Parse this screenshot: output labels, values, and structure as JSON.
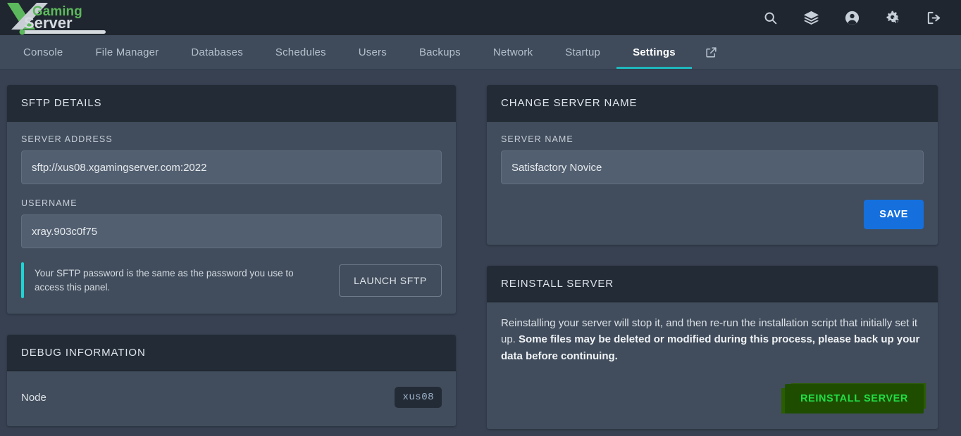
{
  "brand": {
    "name_part1": "Gaming",
    "name_part2": "Server",
    "mark": "X",
    "green": "#5cb85c",
    "light": "#d6dbe0"
  },
  "header": {
    "icons": [
      {
        "name": "search-icon",
        "label": "Search"
      },
      {
        "name": "layers-icon",
        "label": "Servers"
      },
      {
        "name": "account-icon",
        "label": "Account"
      },
      {
        "name": "admin-cogs-icon",
        "label": "Admin"
      },
      {
        "name": "logout-icon",
        "label": "Logout"
      }
    ]
  },
  "nav": {
    "items": [
      {
        "label": "Console",
        "active": false
      },
      {
        "label": "File Manager",
        "active": false
      },
      {
        "label": "Databases",
        "active": false
      },
      {
        "label": "Schedules",
        "active": false
      },
      {
        "label": "Users",
        "active": false
      },
      {
        "label": "Backups",
        "active": false
      },
      {
        "label": "Network",
        "active": false
      },
      {
        "label": "Startup",
        "active": false
      },
      {
        "label": "Settings",
        "active": true
      }
    ],
    "external_link_icon": "external-link-icon",
    "active_underline_color": "#1fb6bd"
  },
  "sftp_panel": {
    "title": "SFTP DETAILS",
    "server_address_label": "SERVER ADDRESS",
    "server_address_value": "sftp://xus08.xgamingserver.com:2022",
    "username_label": "USERNAME",
    "username_value": "xray.903c0f75",
    "note": "Your SFTP password is the same as the password you use to access this panel.",
    "note_accent_color": "#1fd4d4",
    "launch_button": "LAUNCH SFTP"
  },
  "debug_panel": {
    "title": "DEBUG INFORMATION",
    "rows": [
      {
        "label": "Node",
        "value": "xus08"
      }
    ]
  },
  "server_name_panel": {
    "title": "CHANGE SERVER NAME",
    "field_label": "SERVER NAME",
    "field_value": "Satisfactory Novice",
    "save_button": "SAVE",
    "save_button_color": "#1570dd"
  },
  "reinstall_panel": {
    "title": "REINSTALL SERVER",
    "description_normal": "Reinstalling your server will stop it, and then re-run the installation script that initially set it up. ",
    "description_bold": "Some files may be deleted or modified during this process, please back up your data before continuing.",
    "button": "REINSTALL SERVER",
    "button_highlight_color": "#1f4d00",
    "button_text_color": "#22dd44"
  }
}
